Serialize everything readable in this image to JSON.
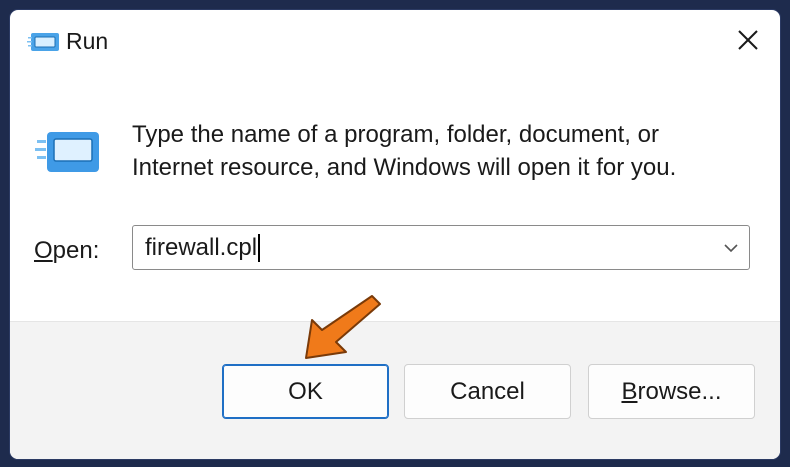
{
  "window": {
    "title": "Run",
    "icon": "run-app-icon",
    "close_icon": "close-icon"
  },
  "body": {
    "icon": "run-app-icon",
    "description_line1": "Type the name of a program, folder, document, or",
    "description_line2": "Internet resource, and Windows will open it for you."
  },
  "open": {
    "label_mnemonic": "O",
    "label_rest": "pen:",
    "value": "firewall.cpl",
    "dropdown_icon": "chevron-down-icon"
  },
  "buttons": {
    "ok_label": "OK",
    "cancel_label": "Cancel",
    "browse_mnemonic": "B",
    "browse_rest": "rowse..."
  },
  "colors": {
    "accent": "#1f6fc5",
    "pointer_arrow": "#f07a1a",
    "frame_background": "#1e2b4d",
    "footer_background": "#f3f3f3"
  }
}
